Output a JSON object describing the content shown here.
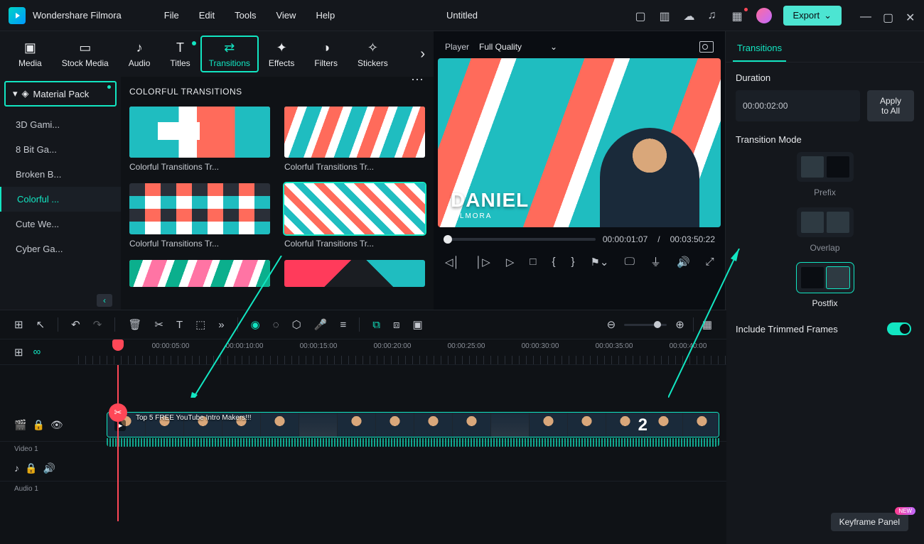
{
  "app": {
    "name": "Wondershare Filmora",
    "document": "Untitled"
  },
  "menu": {
    "file": "File",
    "edit": "Edit",
    "tools": "Tools",
    "view": "View",
    "help": "Help"
  },
  "export": {
    "label": "Export"
  },
  "tabs": {
    "media": "Media",
    "stock": "Stock Media",
    "audio": "Audio",
    "titles": "Titles",
    "transitions": "Transitions",
    "effects": "Effects",
    "filters": "Filters",
    "stickers": "Stickers"
  },
  "sidebar": {
    "header": "Material Pack",
    "items": [
      "3D Gami...",
      "8 Bit Ga...",
      "Broken B...",
      "Colorful ...",
      "Cute We...",
      "Cyber Ga..."
    ]
  },
  "grid": {
    "title": "COLORFUL TRANSITIONS",
    "cards": [
      "Colorful Transitions Tr...",
      "Colorful Transitions Tr...",
      "Colorful Transitions Tr...",
      "Colorful Transitions Tr..."
    ]
  },
  "player": {
    "label": "Player",
    "quality": "Full Quality",
    "current": "00:00:01:07",
    "sep": "/",
    "total": "00:03:50:22",
    "preview_name": "DANIEL",
    "preview_sub": "FILMORA"
  },
  "inspector": {
    "tab": "Transitions",
    "duration_label": "Duration",
    "duration_value": "00:00:02:00",
    "apply_all": "Apply to All",
    "mode_label": "Transition Mode",
    "modes": {
      "prefix": "Prefix",
      "overlap": "Overlap",
      "postfix": "Postfix"
    },
    "trimmed": "Include Trimmed Frames",
    "keyframe": "Keyframe Panel",
    "new_badge": "NEW"
  },
  "timeline": {
    "ticks": [
      "00:00:05:00",
      "00:00:10:00",
      "00:00:15:00",
      "00:00:20:00",
      "00:00:25:00",
      "00:00:30:00",
      "00:00:35:00",
      "00:00:40:00"
    ],
    "video_track": "Video 1",
    "audio_track": "Audio 1",
    "clip_title": "Top 5 FREE YouTube Intro Makers!!!",
    "clip_num": "2"
  }
}
